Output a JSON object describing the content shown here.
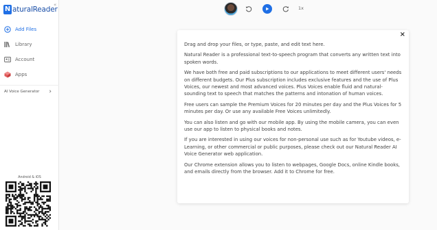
{
  "logo": {
    "mark": "N",
    "text": "aturalReader"
  },
  "sidebar": {
    "collapse_glyph": "«",
    "items": [
      {
        "label": "Add Files",
        "icon": "plus-circle-icon",
        "active": true
      },
      {
        "label": "Library",
        "icon": "library-icon",
        "active": false
      },
      {
        "label": "Account",
        "icon": "account-icon",
        "active": false
      },
      {
        "label": "Apps",
        "icon": "apps-cube-icon",
        "active": false
      }
    ],
    "ai_voice": {
      "label": "AI Voice Generator",
      "chevron": "›"
    },
    "mobile_label": "Android & iOS"
  },
  "toolbar": {
    "speed": "1x"
  },
  "content": {
    "close": "×",
    "paragraphs": [
      "Drag and drop your files, or type, paste, and edit text here.",
      "Natural Reader is a professional text-to-speech program that converts any written text into spoken words.",
      "We have both free and paid subscriptions to our applications to meet different users' needs on different budgets. Our Plus subscription includes exclusive features and the use of Plus Voices, our newest and most advanced voices. Plus Voices enable fluid and natural-sounding text to speech that matches the patterns and intonation of human voices.",
      "Free users can sample the Premium Voices for 20 minutes per day and the Plus Voices for 5 minutes per day. Or use any available Free Voices unlimitedly.",
      "You can also listen and go with our mobile app. By using the mobile camera, you can even use our app to listen to physical books and notes.",
      "If you are interested in using our voices for non-personal use such as for Youtube videos, e-Learning, or other commercial or public purposes, please check out our Natural Reader AI Voice Generator web application.",
      "Our Chrome extension allows you to listen to webpages, Google Docs, online Kindle books, and emails directly from the browser. Add it to Chrome for free."
    ]
  },
  "colors": {
    "accent": "#1f6fe5",
    "text": "#444444",
    "sidebar_bg": "#ffffff",
    "page_bg": "#fafafa"
  }
}
